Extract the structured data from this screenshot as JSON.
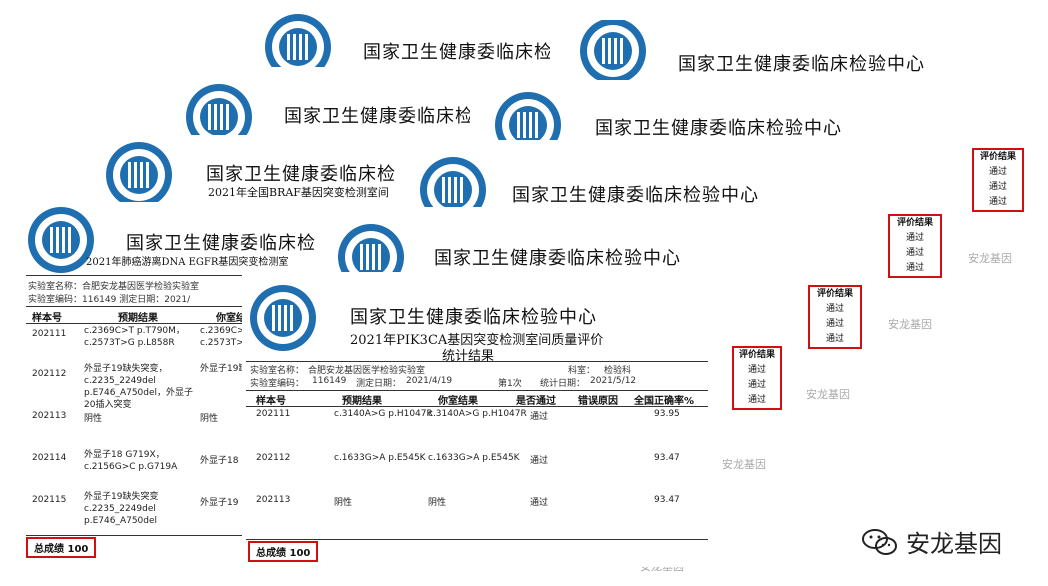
{
  "org_title": "国家卫生健康委临床检验中心",
  "org_title_cut": "国家卫生健康委临床检",
  "bg_subtitles": [
    "2021年全国BRAF基因突变检测室间",
    "2021年肺癌游离DNA EGFR基因突变检测室"
  ],
  "front": {
    "subtitle1": "2021年PIK3CA基因突变检测室间质量评价",
    "subtitle2": "统计结果",
    "lab_name_label": "实验室名称：",
    "lab_name_value": "合肥安龙基因医学检验实验室",
    "dept_label": "科室：",
    "dept_value": "检验科",
    "lab_code_label": "实验室编码：",
    "lab_code_value": "116149",
    "date_label": "测定日期：",
    "date_value": "2021/4/19",
    "round": "第1次",
    "stat_date_label": "统计日期：",
    "stat_date_value": "2021/5/12",
    "headers": [
      "样本号",
      "预期结果",
      "你室结果",
      "是否通过",
      "错误原因",
      "全国正确率%"
    ],
    "rows": [
      [
        "202111",
        "c.3140A>G p.H1047R",
        "c.3140A>G p.H1047R",
        "通过",
        "",
        "93.95"
      ],
      [
        "202112",
        "c.1633G>A p.E545K",
        "c.1633G>A p.E545K",
        "通过",
        "",
        "93.47"
      ],
      [
        "202113",
        "阴性",
        "阴性",
        "通过",
        "",
        "93.47"
      ]
    ],
    "total": "总成绩  100"
  },
  "back": {
    "lab_name_line": "实验室名称：合肥安龙基因医学检验实验室",
    "lab_code_line": "实验室编码：116149      测定日期：2021/",
    "headers": [
      "样本号",
      "预期结果",
      "你室结果"
    ],
    "rows": [
      [
        "202111",
        "c.2369C>T p.T790M，c.2573T>G p.L858R",
        "c.2369C>T p.T790M，c.2573T>G p.L858R"
      ],
      [
        "202112",
        "外显子19缺失突变，c.2235_2249del p.E746_A750del，外显子20插入突变",
        "外显子19缺失突变"
      ],
      [
        "202113",
        "阴性",
        "阴性"
      ],
      [
        "202114",
        "外显子18 G719X，c.2156G>C p.G719A",
        "外显子18"
      ],
      [
        "202115",
        "外显子19缺失突变 c.2235_2249del p.E746_A750del",
        "外显子19"
      ]
    ],
    "total": "总成绩  100"
  },
  "eval_boxes": [
    {
      "title": "评价结果",
      "items": [
        "通过",
        "通过",
        "通过"
      ]
    },
    {
      "title": "评价结果",
      "items": [
        "通过",
        "通过",
        "通过"
      ]
    },
    {
      "title": "评价结果",
      "items": [
        "通过",
        "通过",
        "通过"
      ]
    },
    {
      "title": "评价结果",
      "items": [
        "通过",
        "通过",
        "通过"
      ]
    }
  ],
  "watermark": "安龙基因",
  "brand": "安龙基因",
  "colors": {
    "logo": "#1f6fb0",
    "highlight": "#d01010"
  }
}
